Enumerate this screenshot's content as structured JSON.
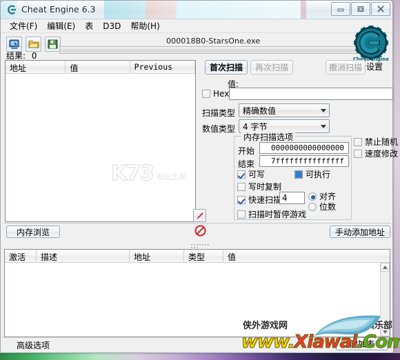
{
  "window": {
    "title": "Cheat Engine 6.3",
    "icon": "cheat-engine-icon",
    "buttons": {
      "minimize": "minimize-icon",
      "maximize": "maximize-icon",
      "close": "close-icon"
    }
  },
  "menu": {
    "items": [
      {
        "label": "文件(F)"
      },
      {
        "label": "编辑(E)"
      },
      {
        "label": "表"
      },
      {
        "label": "D3D"
      },
      {
        "label": "帮助(H)"
      }
    ]
  },
  "toolbar": {
    "process_button": "process-select-icon",
    "open_button": "open-icon",
    "save_button": "save-icon",
    "process_title": "000018B0-StarsOne.exe",
    "progress_value": 0
  },
  "results": {
    "label": "结果:",
    "count": "0",
    "columns": [
      "地址",
      "值",
      "Previous"
    ],
    "rows": []
  },
  "scan": {
    "first_scan": "首次扫描",
    "next_scan": "再次扫描",
    "undo_scan": "撤消扫描",
    "settings_label": "设置",
    "value_label": "值:",
    "value_text": "",
    "hex_label": "Hex",
    "hex_checked": false,
    "scan_type_label": "扫描类型",
    "scan_type_value": "精确数值",
    "value_type_label": "数值类型",
    "value_type_value": "4 字节"
  },
  "memory_options": {
    "title": "内存扫描选项",
    "start_label": "开始",
    "start_value": "0000000000000000",
    "stop_label": "结束",
    "stop_value": "7fffffffffffffff",
    "writable": {
      "label": "可写",
      "checked": true
    },
    "executable": {
      "label": "可执行",
      "checked": true,
      "state": "grayed"
    },
    "copy_on_write": {
      "label": "写时复制",
      "checked": false
    },
    "fast_scan": {
      "label": "快速扫描",
      "checked": true
    },
    "fast_scan_value": "4",
    "alignment_radio": {
      "label": "对齐",
      "selected": true
    },
    "lastdigits_radio": {
      "label": "位数",
      "selected": false
    },
    "pause_game": {
      "label": "扫描时暂停游戏",
      "checked": false
    }
  },
  "side_options": {
    "disable_random": {
      "label": "禁止随机",
      "checked": false
    },
    "speedhack": {
      "label": "速度修改",
      "checked": false
    }
  },
  "mid_buttons": {
    "memory_view": "内存浏览",
    "add_address": "手动添加地址",
    "pointer_icon": "red-arrow-icon",
    "stop_icon": "red-forbidden-icon"
  },
  "address_table": {
    "columns": [
      "激活",
      "描述",
      "地址",
      "类型",
      "值"
    ],
    "rows": []
  },
  "footer": {
    "advanced_options": "高级选项",
    "attach_table": "附加表"
  },
  "watermarks": {
    "k73": "K73",
    "k73_cn": "电玩之家",
    "bottom_left": "侠外游戏网",
    "bottom_right": "玩家俱乐部",
    "url_parts": [
      "www.",
      "Xiawai",
      ".Com"
    ]
  },
  "colors": {
    "accent": "#2c5fa8",
    "ce_teal": "#14788c",
    "danger": "#d42f2f",
    "window_bg": "#f0f0f0"
  }
}
